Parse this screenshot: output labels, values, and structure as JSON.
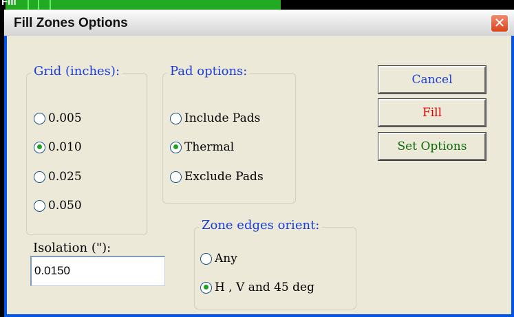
{
  "background": {
    "top_text": "Fill"
  },
  "dialog": {
    "title": "Fill Zones Options",
    "close_label": "✕"
  },
  "grid": {
    "title": "Grid (inches):",
    "options": [
      {
        "label": "0.005",
        "checked": false
      },
      {
        "label": "0.010",
        "checked": true
      },
      {
        "label": "0.025",
        "checked": false
      },
      {
        "label": "0.050",
        "checked": false
      }
    ]
  },
  "pad_options": {
    "title": "Pad options:",
    "options": [
      {
        "label": "Include Pads",
        "checked": false
      },
      {
        "label": "Thermal",
        "checked": true
      },
      {
        "label": "Exclude Pads",
        "checked": false
      }
    ]
  },
  "zone_edges": {
    "title": "Zone edges orient:",
    "options": [
      {
        "label": "Any",
        "checked": false
      },
      {
        "label": "H , V and 45 deg",
        "checked": true
      }
    ]
  },
  "isolation": {
    "label": "Isolation (\"):",
    "value": "0.0150"
  },
  "buttons": {
    "cancel": "Cancel",
    "fill": "Fill",
    "set_options": "Set Options"
  },
  "colors": {
    "group_title": "#1c3fd8",
    "fill_button": "#e00000",
    "set_options_button": "#0b6a0b",
    "radio_dot": "#21a121"
  }
}
